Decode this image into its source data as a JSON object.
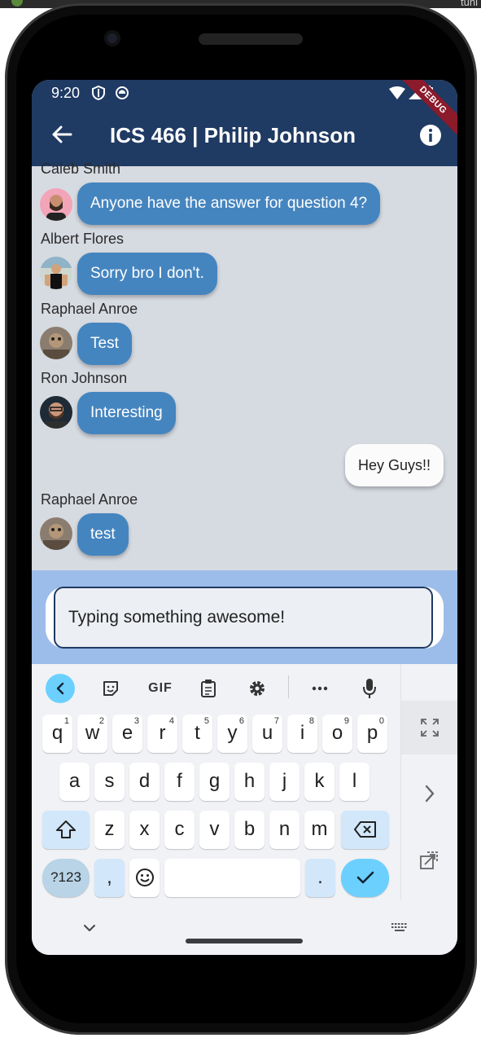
{
  "status": {
    "time": "9:20"
  },
  "debug_banner": "DEBUG",
  "appbar": {
    "title": "ICS 466 | Philip Johnson"
  },
  "messages": [
    {
      "sender": "Caleb Smith",
      "text": "Anyone have the answer for question 4?"
    },
    {
      "sender": "Albert Flores",
      "text": "Sorry bro I don't."
    },
    {
      "sender": "Raphael Anroe",
      "text": "Test"
    },
    {
      "sender": "Ron Johnson",
      "text": "Interesting"
    },
    {
      "sender": "",
      "text": "Hey Guys!!"
    },
    {
      "sender": "Raphael Anroe",
      "text": "test"
    }
  ],
  "composer": {
    "value": "Typing something awesome!"
  },
  "keyboard": {
    "toolbar_gif": "GIF",
    "row1": [
      "q",
      "w",
      "e",
      "r",
      "t",
      "y",
      "u",
      "i",
      "o",
      "p"
    ],
    "row1_hints": [
      "1",
      "2",
      "3",
      "4",
      "5",
      "6",
      "7",
      "8",
      "9",
      "0"
    ],
    "row2": [
      "a",
      "s",
      "d",
      "f",
      "g",
      "h",
      "j",
      "k",
      "l"
    ],
    "row3": [
      "z",
      "x",
      "c",
      "v",
      "b",
      "n",
      "m"
    ],
    "num_key": "?123",
    "comma_key": ",",
    "period_key": "."
  },
  "colors": {
    "appbar": "#1f3a63",
    "chat_bg": "#d6dae1",
    "bubble_other": "#4585bf",
    "bubble_me": "#fbfbfb",
    "input_area": "#9cbde9",
    "accent": "#6cd0ff"
  },
  "top_strip_text": "tuni"
}
